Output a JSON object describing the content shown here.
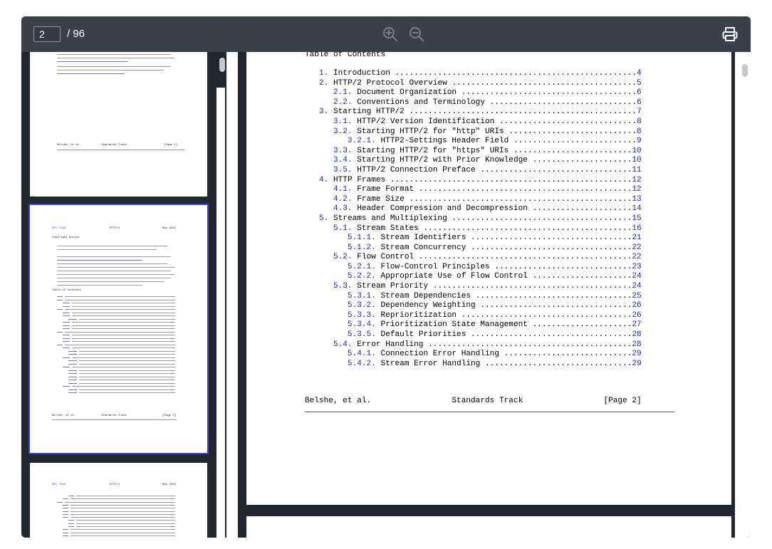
{
  "toolbar": {
    "page_number": "2",
    "page_total": "/ 96",
    "icons": [
      "zoom-in-icon",
      "zoom-out-icon",
      "print-icon"
    ]
  },
  "thumbnails": {
    "thumb1": {
      "footer_left": "Belshe, et al.",
      "footer_mid": "Standards Track",
      "footer_right": "[Page 1]"
    },
    "thumb2": {
      "header_left": "RFC 7540",
      "header_mid": "HTTP/2",
      "header_right": "May 2015",
      "copyright_heading": "Copyright Notice",
      "toc_heading": "Table of Contents",
      "footer_left": "Belshe, et al.",
      "footer_mid": "Standards Track",
      "footer_right": "[Page 2]"
    },
    "thumb3": {
      "header_left": "RFC 7540",
      "header_mid": "HTTP/2",
      "header_right": "May 2015"
    }
  },
  "document": {
    "toc_title": "Table of Contents",
    "toc": [
      {
        "num": "1.",
        "title": "Introduction",
        "page": "4",
        "indent": 0
      },
      {
        "num": "2.",
        "title": "HTTP/2 Protocol Overview",
        "page": "5",
        "indent": 0
      },
      {
        "num": "2.1.",
        "title": "Document Organization",
        "page": "6",
        "indent": 1
      },
      {
        "num": "2.2.",
        "title": "Conventions and Terminology",
        "page": "6",
        "indent": 1
      },
      {
        "num": "3.",
        "title": "Starting HTTP/2",
        "page": "7",
        "indent": 0
      },
      {
        "num": "3.1.",
        "title": "HTTP/2 Version Identification",
        "page": "8",
        "indent": 1
      },
      {
        "num": "3.2.",
        "title": "Starting HTTP/2 for \"http\" URIs",
        "page": "8",
        "indent": 1
      },
      {
        "num": "3.2.1.",
        "title": "HTTP2-Settings Header Field",
        "page": "9",
        "indent": 2
      },
      {
        "num": "3.3.",
        "title": "Starting HTTP/2 for \"https\" URIs",
        "page": "10",
        "indent": 1
      },
      {
        "num": "3.4.",
        "title": "Starting HTTP/2 with Prior Knowledge",
        "page": "10",
        "indent": 1
      },
      {
        "num": "3.5.",
        "title": "HTTP/2 Connection Preface",
        "page": "11",
        "indent": 1
      },
      {
        "num": "4.",
        "title": "HTTP Frames",
        "page": "12",
        "indent": 0
      },
      {
        "num": "4.1.",
        "title": "Frame Format",
        "page": "12",
        "indent": 1
      },
      {
        "num": "4.2.",
        "title": "Frame Size",
        "page": "13",
        "indent": 1
      },
      {
        "num": "4.3.",
        "title": "Header Compression and Decompression",
        "page": "14",
        "indent": 1
      },
      {
        "num": "5.",
        "title": "Streams and Multiplexing",
        "page": "15",
        "indent": 0
      },
      {
        "num": "5.1.",
        "title": "Stream States",
        "page": "16",
        "indent": 1
      },
      {
        "num": "5.1.1.",
        "title": "Stream Identifiers",
        "page": "21",
        "indent": 2
      },
      {
        "num": "5.1.2.",
        "title": "Stream Concurrency",
        "page": "22",
        "indent": 2
      },
      {
        "num": "5.2.",
        "title": "Flow Control",
        "page": "22",
        "indent": 1
      },
      {
        "num": "5.2.1.",
        "title": "Flow-Control Principles",
        "page": "23",
        "indent": 2
      },
      {
        "num": "5.2.2.",
        "title": "Appropriate Use of Flow Control",
        "page": "24",
        "indent": 2
      },
      {
        "num": "5.3.",
        "title": "Stream Priority",
        "page": "24",
        "indent": 1
      },
      {
        "num": "5.3.1.",
        "title": "Stream Dependencies",
        "page": "25",
        "indent": 2
      },
      {
        "num": "5.3.2.",
        "title": "Dependency Weighting",
        "page": "26",
        "indent": 2
      },
      {
        "num": "5.3.3.",
        "title": "Reprioritization",
        "page": "26",
        "indent": 2
      },
      {
        "num": "5.3.4.",
        "title": "Prioritization State Management",
        "page": "27",
        "indent": 2
      },
      {
        "num": "5.3.5.",
        "title": "Default Priorities",
        "page": "28",
        "indent": 2
      },
      {
        "num": "5.4.",
        "title": "Error Handling",
        "page": "28",
        "indent": 1
      },
      {
        "num": "5.4.1.",
        "title": "Connection Error Handling",
        "page": "29",
        "indent": 2
      },
      {
        "num": "5.4.2.",
        "title": "Stream Error Handling",
        "page": "29",
        "indent": 2
      }
    ],
    "footer_left": "Belshe, et al.",
    "footer_mid": "Standards Track",
    "footer_right": "[Page 2]"
  },
  "colors": {
    "toolbar_bg": "#3a3f48",
    "viewer_bg": "#22262e",
    "link_blue": "#1f24c4",
    "selected_outline": "#3d3fdc"
  }
}
